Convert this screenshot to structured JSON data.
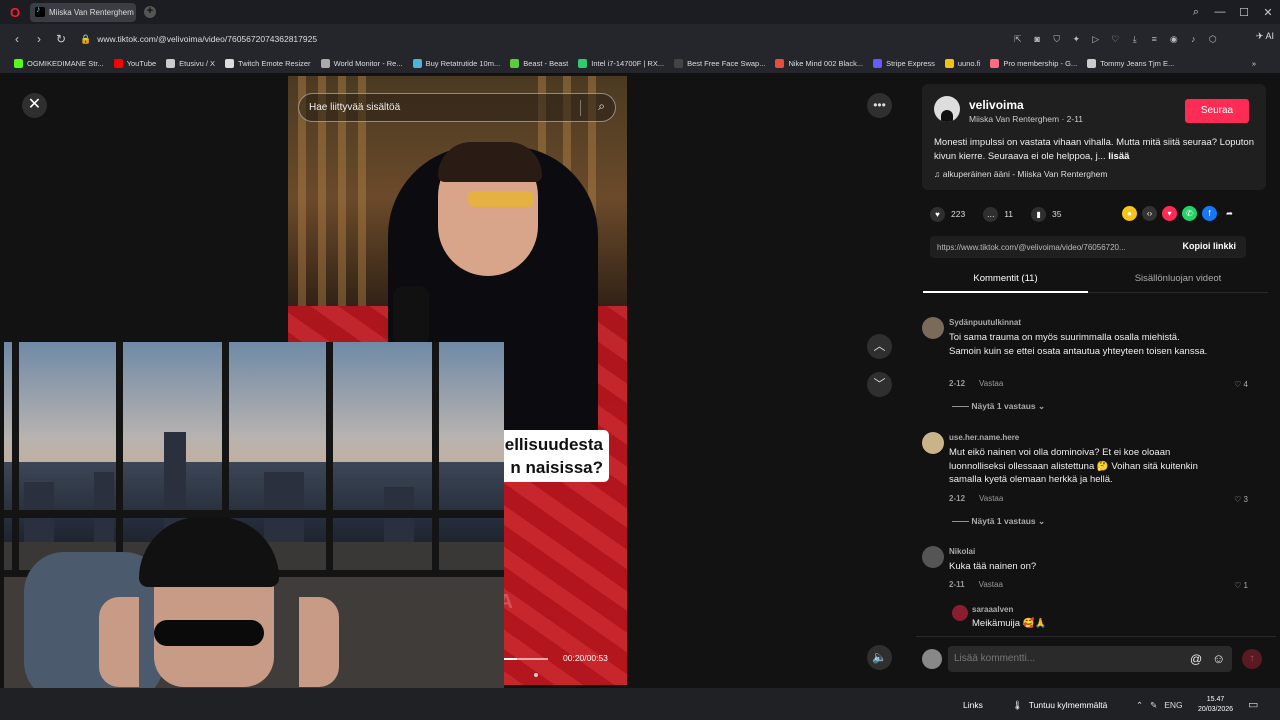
{
  "browser": {
    "tab_title": "Miiska Van Renterghem",
    "url": "www.tiktok.com/@velivoima/video/7605672074362817925",
    "ai_label": "AI",
    "bookmarks": [
      {
        "label": "OGMIKEDIMANE Str...",
        "color": "#53fc18"
      },
      {
        "label": "YouTube",
        "color": "#ff0000"
      },
      {
        "label": "Etusivu / X",
        "color": "#cccccc"
      },
      {
        "label": "Twitch Emote Resizer",
        "color": "#dddddd"
      },
      {
        "label": "World Monitor - Re...",
        "color": "#aaaaaa"
      },
      {
        "label": "Buy Retatrutide 10m...",
        "color": "#4fb3d9"
      },
      {
        "label": "Beast - Beast",
        "color": "#5ccc3a"
      },
      {
        "label": "Intel i7-14700F | RX...",
        "color": "#2ecc71"
      },
      {
        "label": "Best Free Face Swap...",
        "color": "#444444"
      },
      {
        "label": "Nike Mind 002 Black...",
        "color": "#e74c3c"
      },
      {
        "label": "Stripe Express",
        "color": "#635bff"
      },
      {
        "label": "uuno.fi",
        "color": "#f1c40f"
      },
      {
        "label": "Pro membership - G...",
        "color": "#ff6b81"
      },
      {
        "label": "Tommy Jeans Tjm E...",
        "color": "#cccccc"
      }
    ]
  },
  "video": {
    "search_placeholder": "Hae liittyvää sisältöä",
    "caption_line1": "ellisuudesta",
    "caption_line2": "n naisissa?",
    "time": "00:20/00:53",
    "progress": 0.377
  },
  "author": {
    "username": "velivoima",
    "subtitle": "Miiska Van Renterghem · 2-11",
    "follow_label": "Seuraa",
    "description": "Monesti impulssi on vastata vihaan vihalla. Mutta mitä siitä seuraa? Loputon kivun kierre. Seuraava ei ole helppoa, j...",
    "more_label": "lisää",
    "music": "alkuperäinen ääni - Miiska Van Renterghem"
  },
  "stats": {
    "likes": "223",
    "comments": "11",
    "saves": "35"
  },
  "link": {
    "url": "https://www.tiktok.com/@velivoima/video/76056720...",
    "copy_label": "Kopioi linkki"
  },
  "tabs": {
    "comments": "Kommentit (11)",
    "creator_videos": "Sisällönluojan videot"
  },
  "comments": [
    {
      "user": "Sydänpuutulkinnat",
      "text": "Toi sama trauma on myös suurimmalla osalla miehistä. Samoin kuin se ettei osata antautua yhteyteen toisen kanssa.",
      "date": "2-12",
      "reply_label": "Vastaa",
      "likes": "4",
      "replies_label": "Näytä 1 vastaus"
    },
    {
      "user": "use.her.name.here",
      "text": "Mut eikö nainen voi olla dominoiva? Et ei koe oloaan luonnolliseksi ollessaan alistettuna 🤔 Voihan sitä kuitenkin samalla kyetä olemaan herkkä ja hellä.",
      "date": "2-12",
      "reply_label": "Vastaa",
      "likes": "3",
      "replies_label": "Näytä 1 vastaus"
    },
    {
      "user": "Nikolai",
      "text": "Kuka tää nainen on?",
      "date": "2-11",
      "reply_label": "Vastaa",
      "likes": "1"
    }
  ],
  "reply": {
    "user": "saraaalven",
    "text": "Meikämuija 🥰🙏"
  },
  "comment_input_placeholder": "Lisää kommentti...",
  "taskbar": {
    "links": "Links",
    "weather": "Tuntuu kylmemmältä",
    "lang": "ENG",
    "time": "15.47",
    "date": "20/03/2026"
  }
}
